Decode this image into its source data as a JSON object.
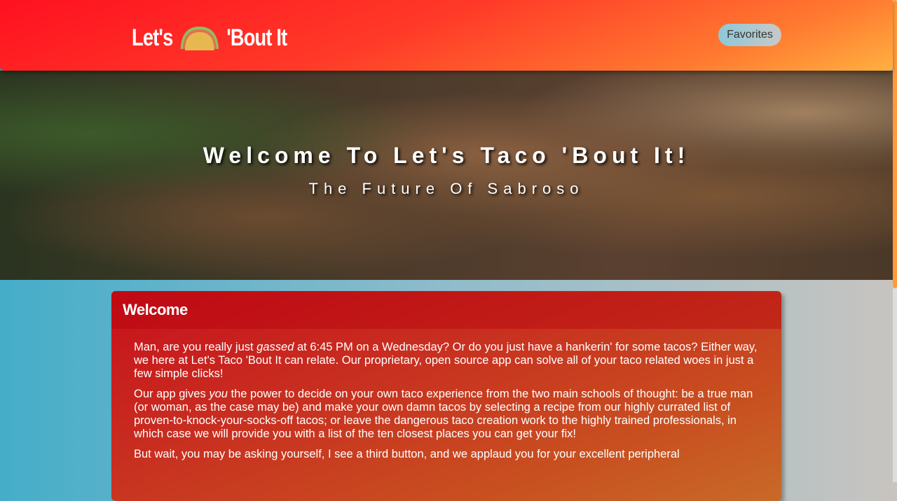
{
  "header": {
    "logo_left": "Let's",
    "logo_right": "'Bout It",
    "favorites_label": "Favorites"
  },
  "hero": {
    "title": "Welcome To Let's Taco 'Bout It!",
    "subtitle": "The Future Of Sabroso"
  },
  "welcome": {
    "heading": "Welcome",
    "p1_a": "Man, are you really just ",
    "p1_em": "gassed",
    "p1_b": " at 6:45 PM on a Wednesday? Or do you just have a hankerin' for some tacos? Either way, we here at Let's Taco 'Bout It can relate. Our proprietary, open source app can solve all of your taco related woes in just a few simple clicks!",
    "p2_a": "Our app gives ",
    "p2_em": "you",
    "p2_b": " the power to decide on your own taco experience from the two main schools of thought: be a true man (or woman, as the case may be) and make your own damn tacos by selecting a recipe from our highly currated list of proven-to-knock-your-socks-off tacos; or leave the dangerous taco creation work to the highly trained professionals, in which case we will provide you with a list of the ten closest places you can get your fix!",
    "p3": "But wait, you may be asking yourself, I see a third button, and we applaud you for your excellent peripheral"
  }
}
